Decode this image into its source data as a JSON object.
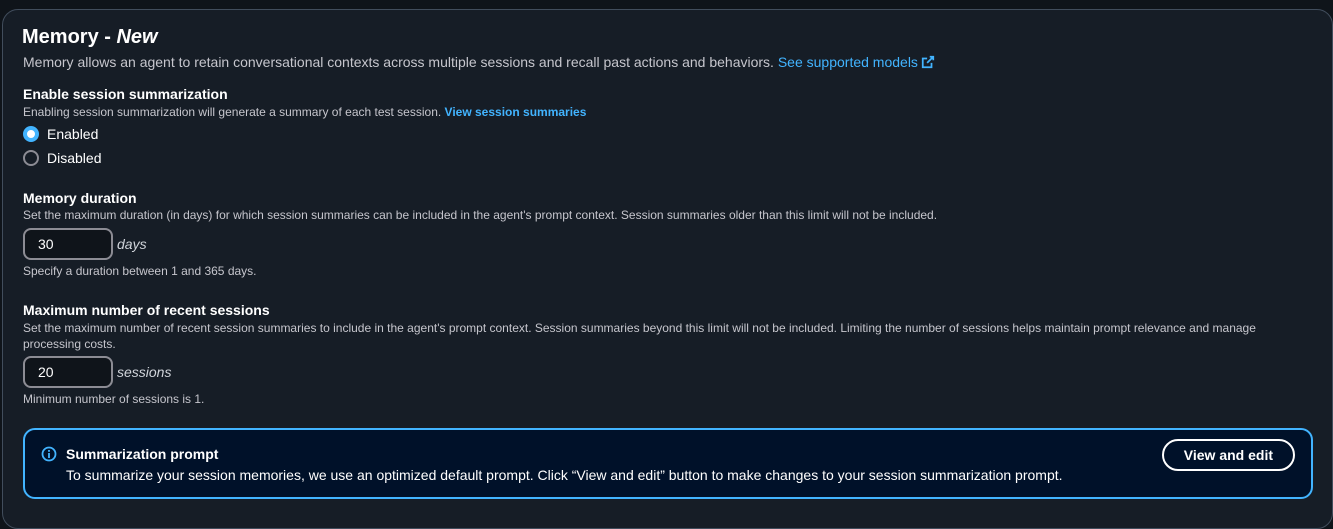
{
  "memory": {
    "title": "Memory - ",
    "title_new": "New",
    "description": "Memory allows an agent to retain conversational contexts across multiple sessions and recall past actions and behaviors.",
    "supported_models_link": "See supported models"
  },
  "summarization": {
    "label": "Enable session summarization",
    "help": "Enabling session summarization will generate a summary of each test session.",
    "view_link": "View session summaries",
    "options": [
      {
        "label": "Enabled",
        "checked": true
      },
      {
        "label": "Disabled",
        "checked": false
      }
    ]
  },
  "duration": {
    "label": "Memory duration",
    "help": "Set the maximum duration (in days) for which session summaries can be included in the agent's prompt context. Session summaries older than this limit will not be included.",
    "value": "30",
    "unit": "days",
    "constraint": "Specify a duration between 1 and 365 days."
  },
  "sessions": {
    "label": "Maximum number of recent sessions",
    "help": "Set the maximum number of recent session summaries to include in the agent's prompt context. Session summaries beyond this limit will not be included. Limiting the number of sessions helps maintain prompt relevance and manage processing costs.",
    "value": "20",
    "unit": "sessions",
    "constraint": "Minimum number of sessions is 1."
  },
  "prompt_alert": {
    "title": "Summarization prompt",
    "text": "To summarize your session memories, we use an optimized default prompt. Click “View and edit” button to make changes to your session summarization prompt.",
    "button": "View and edit"
  },
  "colors": {
    "accent": "#42b4ff",
    "panel_bg": "#161d26",
    "alert_bg": "#001129"
  }
}
